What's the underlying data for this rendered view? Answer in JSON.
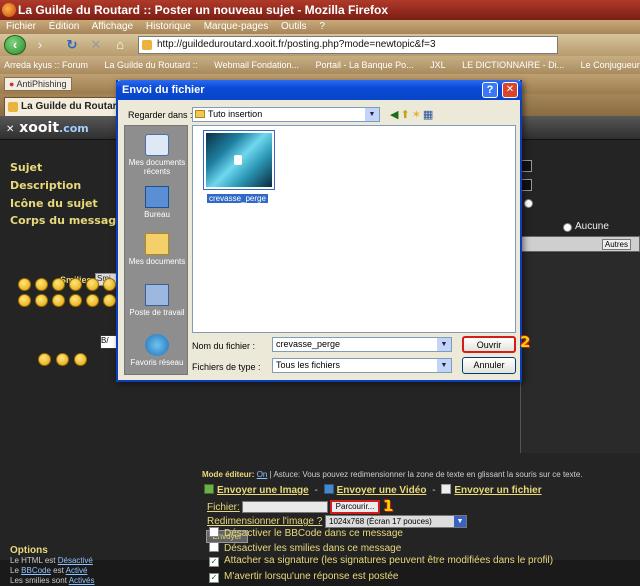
{
  "browser": {
    "title": "La Guilde du Routard :: Poster un nouveau sujet - Mozilla Firefox",
    "menu": [
      "Fichier",
      "Édition",
      "Affichage",
      "Historique",
      "Marque-pages",
      "Outils",
      "?"
    ],
    "url": "http://guildeduroutard.xooit.fr/posting.php?mode=newtopic&f=3",
    "bookmarks": [
      "Arreda kyus :: Forum",
      "La Guilde du Routard ::",
      "Webmail Fondation...",
      "Portail - La Banque Po...",
      "JXL",
      "LE DICTIONNAIRE - Di...",
      "Le Conjugueur - Conju..."
    ],
    "antiphishing": "AntiPhishing",
    "tab_label": "La Guilde du Routard :: ..."
  },
  "site": {
    "logo": "xooit",
    "logo_suffix": ".com"
  },
  "form": {
    "labels": [
      "Sujet",
      "Description",
      "Icône du sujet",
      "Corps du message"
    ],
    "smilies_label": "Smilies:",
    "smilies_select": "Smi",
    "bbcode_tip": "B/",
    "aucune": "Aucune",
    "autres_label": "Autres",
    "mode_editeur_label": "Mode éditeur:",
    "mode_editeur_value": "On",
    "astuce": "| Astuce: Vous pouvez redimensionner la zone de texte en glissant la souris sur ce texte.",
    "upload_links": [
      "Envoyer une Image",
      "Envoyer une Vidéo",
      "Envoyer un fichier"
    ],
    "fichier_label": "Fichier:",
    "parcourir_label": "Parcourir...",
    "redim_label": "Redimensionner l'image ?",
    "redim_value": "1024x768 (Écran 17 pouces)",
    "envoyer_label": "Envoyer",
    "badge_1": "1",
    "badge_2": "2"
  },
  "options": {
    "title": "Options",
    "html_line_prefix": "Le HTML est",
    "html_state": "Désactivé",
    "bbcode_line_prefix": "Le",
    "bbcode_link": "BBCode",
    "bbcode_mid": "est",
    "bbcode_state": "Activé",
    "smilies_line_prefix": "Les smilies sont",
    "smilies_state": "Activés"
  },
  "checkboxes": [
    {
      "label": "Désactiver le BBCode dans ce message",
      "checked": false
    },
    {
      "label": "Désactiver les smilies dans ce message",
      "checked": false
    },
    {
      "label": "Attacher sa signature (les signatures peuvent être modifiées dans le profil)",
      "checked": true
    },
    {
      "label": "M'avertir lorsqu'une réponse est postée",
      "checked": true
    }
  ],
  "dialog": {
    "title": "Envoi du fichier",
    "look_in_label": "Regarder dans :",
    "look_in_value": "Tuto insertion",
    "places": [
      "Mes documents récents",
      "Bureau",
      "Mes documents",
      "Poste de travail",
      "Favoris réseau"
    ],
    "file_caption": "crevasse_perge",
    "filename_label": "Nom du fichier :",
    "filename_value": "crevasse_perge",
    "filetype_label": "Fichiers de type :",
    "filetype_value": "Tous les fichiers",
    "open_label": "Ouvrir",
    "cancel_label": "Annuler"
  }
}
